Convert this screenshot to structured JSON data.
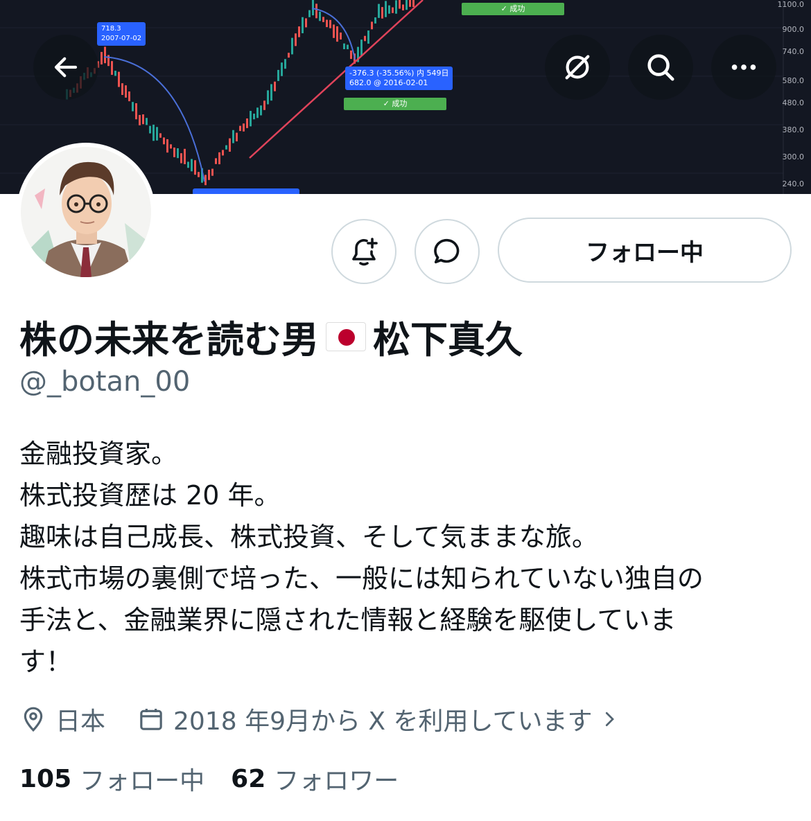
{
  "banner": {
    "axis_labels": [
      "1100.0",
      "900.0",
      "740.0",
      "580.0",
      "480.0",
      "380.0",
      "300.0",
      "240.0"
    ],
    "tag_top_price": "718.3",
    "tag_top_date": "2007-07-02",
    "tag_mid_line1": "-376.3 (-35.56%) 内 549日",
    "tag_mid_line2": "682.0 @ 2016-02-01",
    "success_label": "✓ 成功"
  },
  "toolbar": {
    "back_icon": "arrow-left-icon",
    "grok_icon": "grok-icon",
    "search_icon": "search-icon",
    "more_icon": "more-icon"
  },
  "profile": {
    "display_name": "株の未来を読む男",
    "name_suffix": "松下真久",
    "handle": "@_botan_00",
    "follow_button": "フォロー中",
    "bio_lines": [
      "金融投資家。",
      "株式投資歴は 20 年。",
      "趣味は自己成長、株式投資、そして気ままな旅。",
      "株式市場の裏側で培った、一般には知られていない独自の",
      "手法と、金融業界に隠された情報と経験を駆使していま",
      "す！"
    ],
    "location": "日本",
    "joined": "2018 年9月から X を利用しています",
    "following_count": "105",
    "following_label": "フォロー中",
    "followers_count": "62",
    "followers_label": "フォロワー"
  }
}
